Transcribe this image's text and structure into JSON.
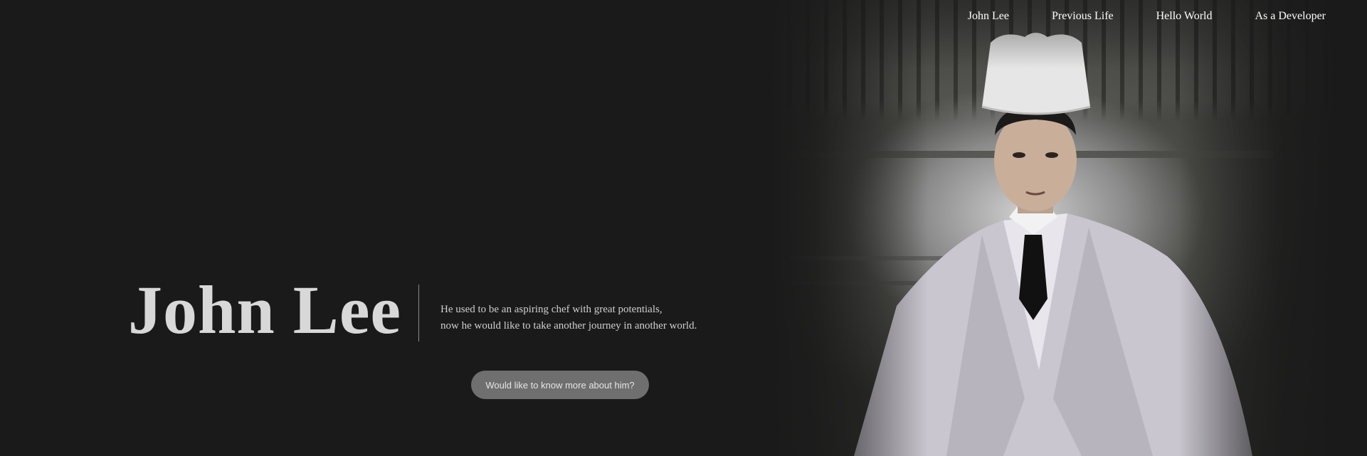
{
  "nav": {
    "items": [
      {
        "label": "John Lee"
      },
      {
        "label": "Previous Life"
      },
      {
        "label": "Hello World"
      },
      {
        "label": "As a Developer"
      }
    ]
  },
  "hero": {
    "title": "John Lee",
    "tagline_line1": "He used to be an aspiring chef with great potentials,",
    "tagline_line2": "now he would like to take another journey in another world.",
    "cta_label": "Would like to know more about him?"
  },
  "colors": {
    "background": "#1a1a1a",
    "title": "#d8d8d8",
    "button": "#6f6f6f"
  }
}
